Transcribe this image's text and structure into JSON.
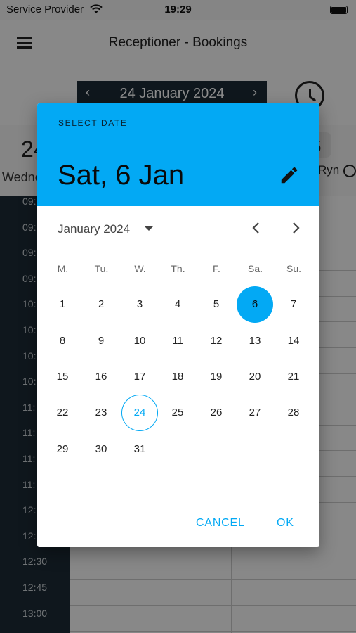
{
  "status_bar": {
    "carrier": "Service Provider",
    "time": "19:29"
  },
  "app_bar": {
    "title": "Receptioner - Bookings"
  },
  "date_nav": {
    "prev": "‹",
    "date": "24 January 2024",
    "next": "›"
  },
  "day_header": {
    "day_number": "24",
    "day_name": "Wedne",
    "staff_number": "6",
    "staff_name": "Ryn"
  },
  "time_column": {
    "labels": [
      "09:",
      "09:",
      "09:",
      "09:",
      "10:",
      "10:",
      "10:",
      "10:",
      "11:",
      "11:",
      "11:",
      "11:",
      "12:",
      "12:",
      "12:30",
      "12:45",
      "13:00"
    ]
  },
  "date_picker": {
    "help_text": "SELECT DATE",
    "selected_text": "Sat, 6 Jan",
    "month_label": "January 2024",
    "weekdays": [
      "M.",
      "Tu.",
      "W.",
      "Th.",
      "F.",
      "Sa.",
      "Su."
    ],
    "days": [
      "1",
      "2",
      "3",
      "4",
      "5",
      "6",
      "7",
      "8",
      "9",
      "10",
      "11",
      "12",
      "13",
      "14",
      "15",
      "16",
      "17",
      "18",
      "19",
      "20",
      "21",
      "22",
      "23",
      "24",
      "25",
      "26",
      "27",
      "28",
      "29",
      "30",
      "31"
    ],
    "selected_day": "6",
    "today": "24",
    "cancel_label": "CANCEL",
    "ok_label": "OK"
  },
  "colors": {
    "accent": "#03a9f4",
    "sidebar": "#1d2b36"
  }
}
